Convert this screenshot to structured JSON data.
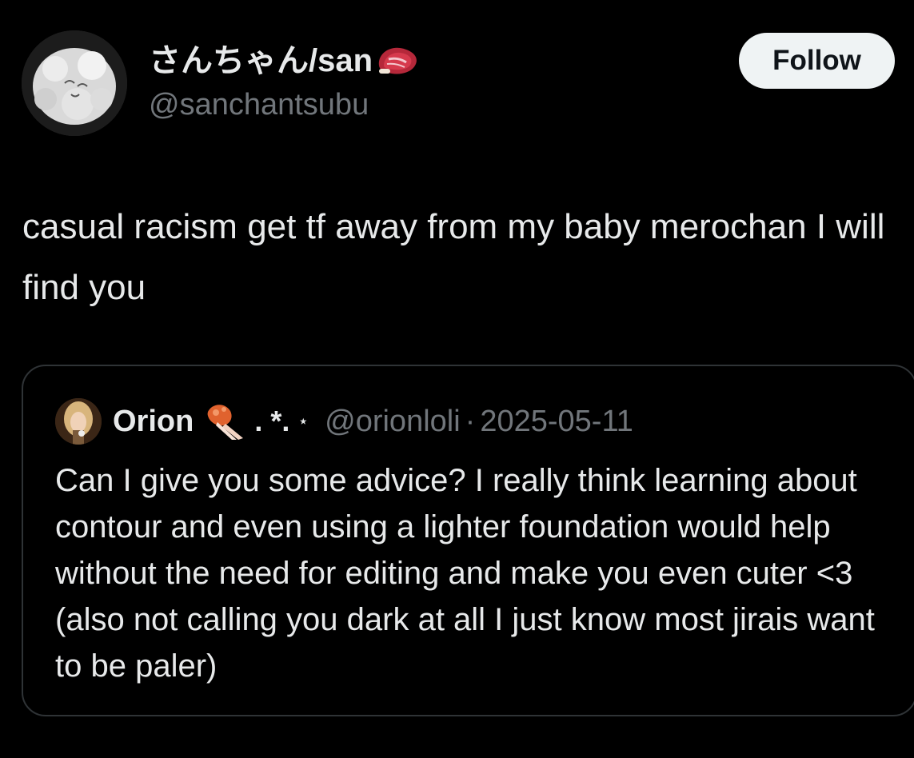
{
  "author": {
    "display_name": "さんちゃん/san",
    "name_emoji": "steak-icon",
    "handle": "@sanchantsubu"
  },
  "follow_label": "Follow",
  "post": {
    "text": "casual racism get tf away from my baby merochan I will find you"
  },
  "quote": {
    "name": "Orion",
    "name_emoji": "rocket-icon",
    "decoration": ". *.",
    "decoration_small": "⋆",
    "handle": "@orionloli",
    "separator": "·",
    "date": "2025-05-11",
    "text": "Can I give you some advice? I really think learning about contour and even using a lighter foundation would help without the need for editing and make you even cuter <3 (also not calling you dark at all I just know most jirais want to be paler)"
  },
  "colors": {
    "background": "#000000",
    "text_primary": "#e7e9ea",
    "text_secondary": "#71767b",
    "border": "#2f3336",
    "follow_bg": "#eff3f4"
  }
}
